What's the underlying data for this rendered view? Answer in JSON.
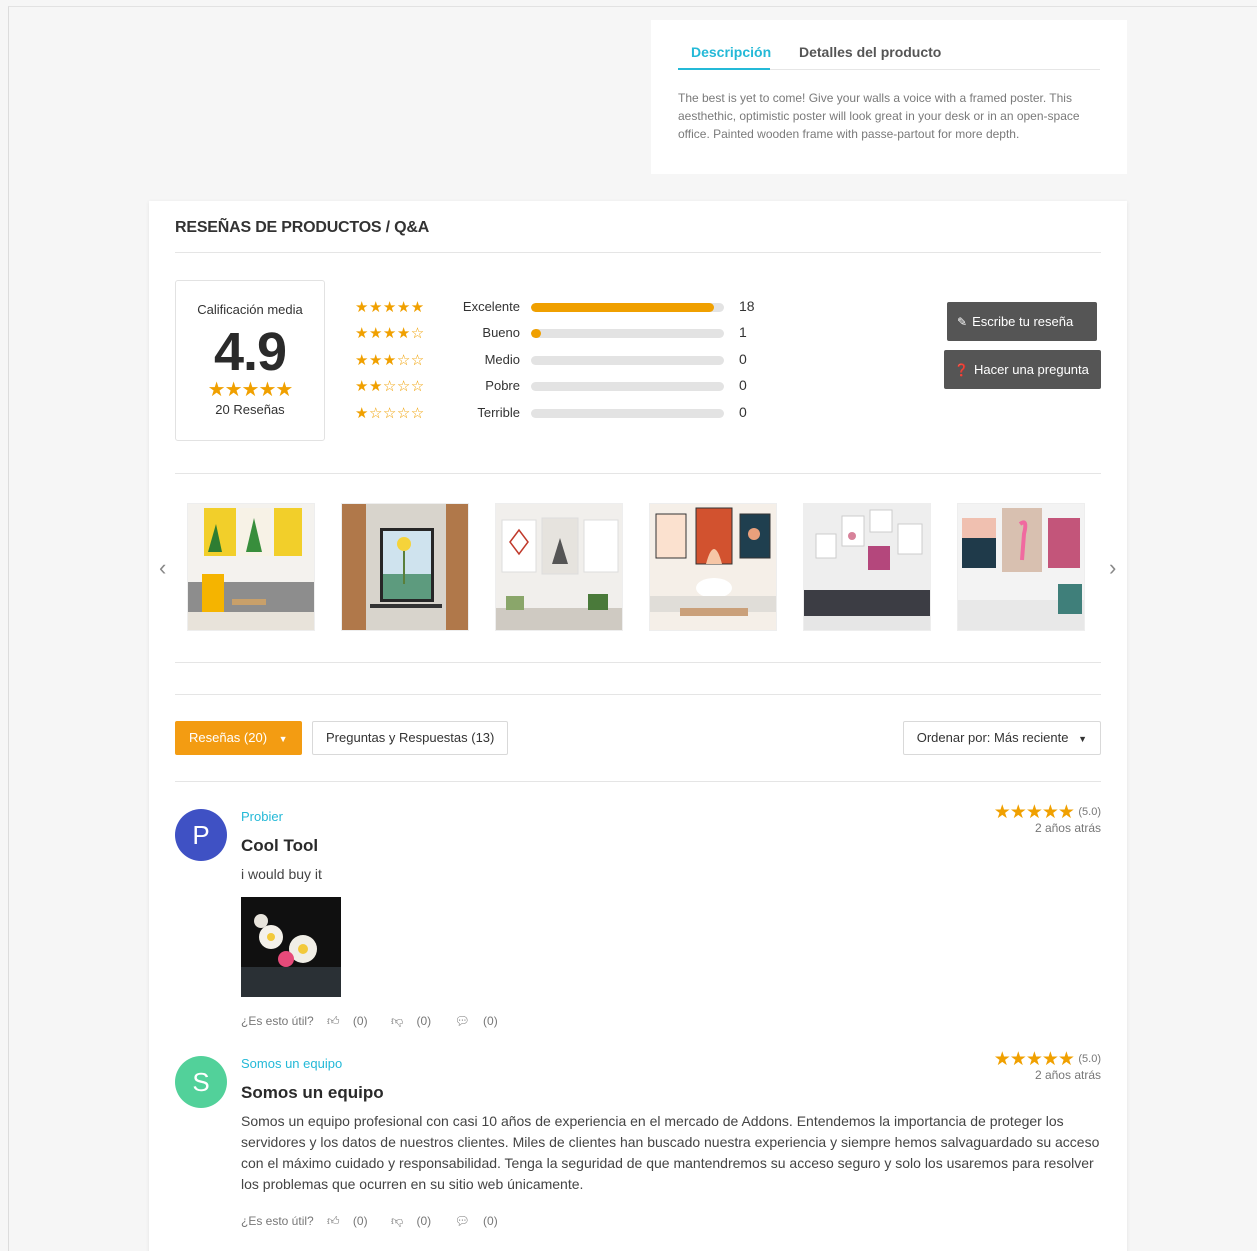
{
  "description_card": {
    "tabs": [
      {
        "label": "Descripción",
        "active": true
      },
      {
        "label": "Detalles del producto",
        "active": false
      }
    ],
    "text": "The best is yet to come! Give your walls a voice with a framed poster. This aesthethic, optimistic poster will look great in your desk or in an open-space office. Painted wooden frame with passe-partout for more depth."
  },
  "reviews": {
    "title": "RESEÑAS DE PRODUCTOS / Q&A",
    "average": {
      "label": "Calificación media",
      "value": "4.9",
      "stars": "★★★★★",
      "count_label": "20 Reseñas"
    },
    "distribution": [
      {
        "stars": "★★★★★",
        "label": "Excelente",
        "count": "18",
        "fill": 0.95
      },
      {
        "stars": "★★★★☆",
        "label": "Bueno",
        "count": "1",
        "fill": 0.05
      },
      {
        "stars": "★★★☆☆",
        "label": "Medio",
        "count": "0",
        "fill": 0
      },
      {
        "stars": "★★☆☆☆",
        "label": "Pobre",
        "count": "0",
        "fill": 0
      },
      {
        "stars": "★☆☆☆☆",
        "label": "Terrible",
        "count": "0",
        "fill": 0
      }
    ],
    "buttons": {
      "write_review": "Escribe tu reseña",
      "ask_question": "Hacer una pregunta"
    },
    "carousel": {
      "prev": "‹",
      "next": "›",
      "images": [
        "yellow-living-room",
        "flower-frame-hallway",
        "geometric-deer-posters",
        "abstract-arches-posters",
        "botanical-gallery-wall",
        "flamingo-coastal-posters"
      ]
    },
    "filters": {
      "reviews_tab": "Reseñas (20)",
      "qa_tab": "Preguntas y Respuestas (13)",
      "sort_label": "Ordenar por: Más reciente"
    },
    "items": [
      {
        "avatar_letter": "P",
        "avatar_color": "#3f51c4",
        "author": "Probier",
        "title": "Cool Tool",
        "body": "i would buy it",
        "stars": "★★★★★",
        "score": "(5.0)",
        "time": "2 años atrás",
        "helpful_label": "¿Es esto útil?",
        "likes": "(0)",
        "dislikes": "(0)",
        "comments": "(0)"
      },
      {
        "avatar_letter": "S",
        "avatar_color": "#52d19a",
        "author": "Somos un equipo",
        "title": "Somos un equipo",
        "body": "Somos un equipo profesional con casi 10 años de experiencia en el mercado de Addons. Entendemos la importancia de proteger los servidores y los datos de nuestros clientes. Miles de clientes han buscado nuestra experiencia y siempre hemos salvaguardado su acceso con el máximo cuidado y responsabilidad. Tenga la seguridad de que mantendremos su acceso seguro y solo los usaremos para resolver los problemas que ocurren en su sitio web únicamente.",
        "stars": "★★★★★",
        "score": "(5.0)",
        "time": "2 años atrás",
        "helpful_label": "¿Es esto útil?",
        "likes": "(0)",
        "dislikes": "(0)",
        "comments": "(0)"
      }
    ]
  }
}
